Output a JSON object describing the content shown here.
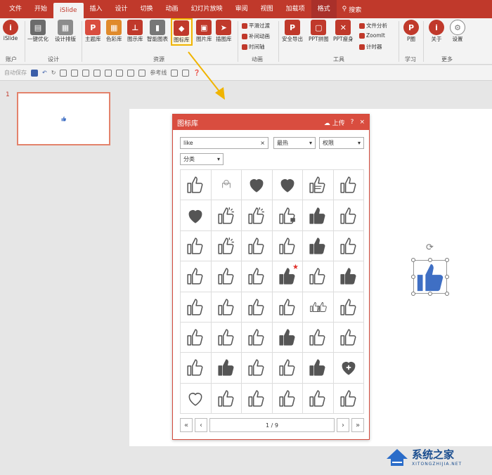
{
  "tabs": [
    {
      "label": "文件",
      "active": false
    },
    {
      "label": "开始",
      "active": false
    },
    {
      "label": "iSlide",
      "active": true
    },
    {
      "label": "插入",
      "active": false
    },
    {
      "label": "设计",
      "active": false
    },
    {
      "label": "切换",
      "active": false
    },
    {
      "label": "动画",
      "active": false
    },
    {
      "label": "幻灯片放映",
      "active": false
    },
    {
      "label": "审阅",
      "active": false
    },
    {
      "label": "视图",
      "active": false
    },
    {
      "label": "加载项",
      "active": false
    },
    {
      "label": "格式",
      "active": false
    }
  ],
  "search_label": "搜索",
  "ribbon": {
    "account": {
      "label": "iSlide",
      "group": "账户"
    },
    "design": {
      "one_click": "一键优化",
      "layout": "设计排版",
      "group": "设计"
    },
    "resources": {
      "theme": "主题库",
      "color": "色彩库",
      "chart": "图示库",
      "smart": "智能图表",
      "icon": "图标库",
      "picture": "图片库",
      "illus": "插图库",
      "group": "资源"
    },
    "animation": {
      "smooth": "平滑过渡",
      "tween": "补间动画",
      "time": "时间轴",
      "group": "动画"
    },
    "tools": {
      "export": "安全导出",
      "stitch": "PPT拼图",
      "slim": "PPT瘦身",
      "analyze": "文件分析",
      "zoom": "ZoomIt",
      "timer": "计时器",
      "group": "工具"
    },
    "learn": {
      "p": "P圈",
      "group": "学习"
    },
    "more": {
      "about": "关于",
      "settings": "设置",
      "group": "更多"
    }
  },
  "qat": {
    "autosave": "自动保存",
    "guides": "参考线"
  },
  "slide_number": "1",
  "dialog": {
    "title": "图标库",
    "upload": "上传",
    "help": "?",
    "close": "×",
    "search_value": "like",
    "sort": "最热",
    "rights": "权限",
    "category": "分类",
    "page_info": "1 / 9"
  },
  "icons": {
    "rows": [
      [
        "hand-like",
        "ring-like",
        "heart",
        "heart",
        "fist-like",
        "outline-like"
      ],
      [
        "heart",
        "spark-like",
        "spark-like",
        "lock-like",
        "solid-like",
        "outline-like"
      ],
      [
        "outline-like",
        "spark-like",
        "outline-like",
        "outline-like",
        "solid-like",
        "outline-like"
      ],
      [
        "outline-like",
        "outline-like",
        "outline-like",
        "solid-like-star",
        "outline-like",
        "solid-like"
      ],
      [
        "outline-like",
        "outline-like",
        "outline-like",
        "outline-like",
        "pair-like",
        "outline-like"
      ],
      [
        "outline-like",
        "outline-like",
        "outline-like",
        "solid-like",
        "outline-like",
        "outline-like"
      ],
      [
        "outline-like",
        "solid-like",
        "outline-like",
        "outline-like",
        "solid-like",
        "heart-plus"
      ],
      [
        "heart-outline",
        "outline-like",
        "outline-like",
        "outline-like",
        "outline-like",
        "outline-like"
      ]
    ]
  },
  "colors": {
    "brand": "#c0392b",
    "dialog": "#d94d3f",
    "icon_gray": "#555555",
    "blue_like": "#3f6fc4"
  },
  "watermark": {
    "text": "系统之家",
    "url": "XITONGZHIJIA.NET"
  }
}
